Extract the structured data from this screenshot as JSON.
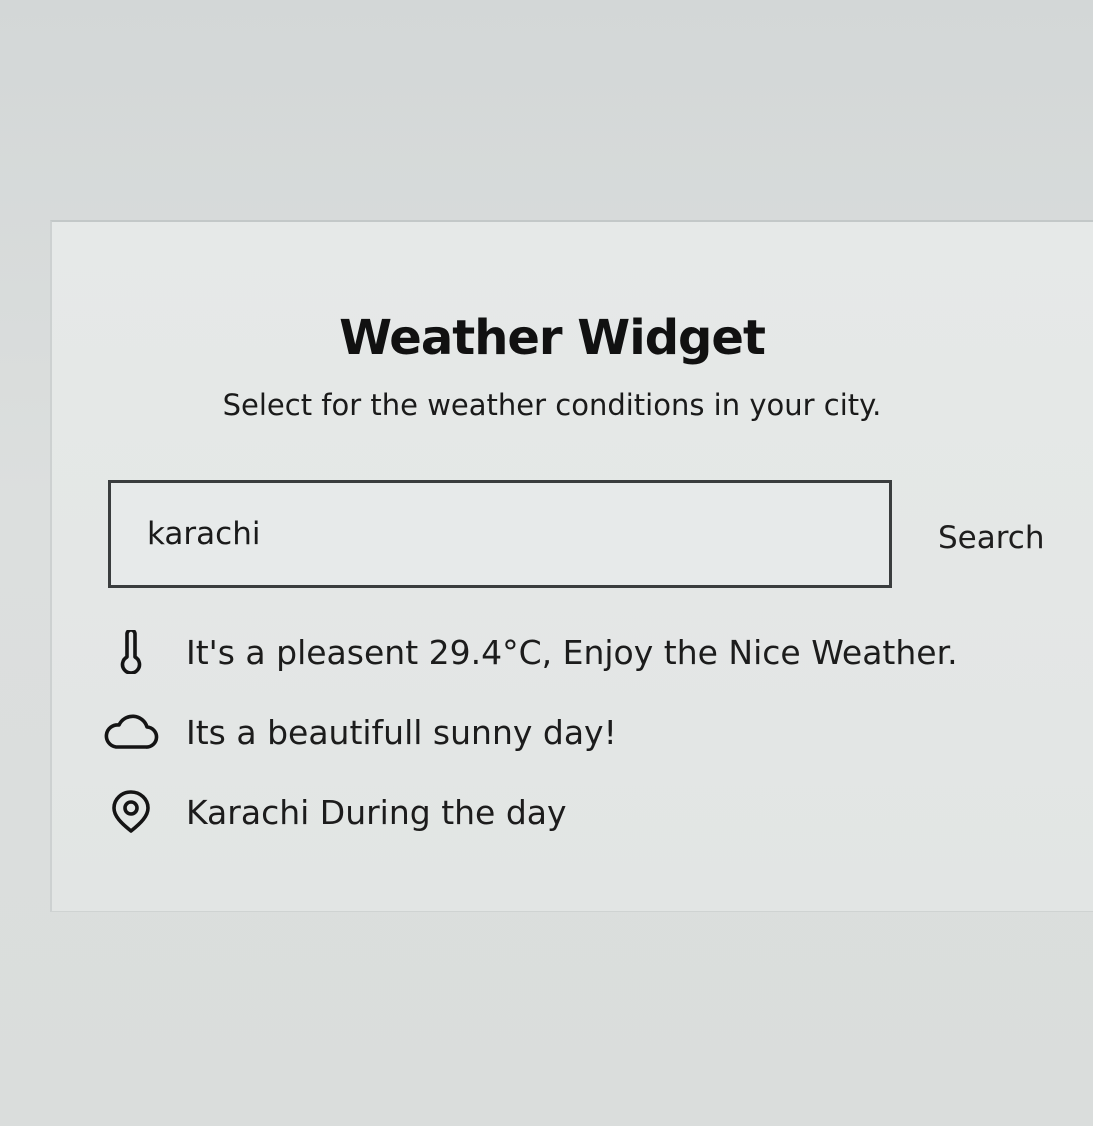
{
  "widget": {
    "title": "Weather Widget",
    "subtitle": "Select for the weather conditions in your city."
  },
  "search": {
    "value": "karachi",
    "placeholder": "",
    "button_label": "Search"
  },
  "results": [
    {
      "icon": "thermometer-icon",
      "text": "It's a pleasent 29.4°C, Enjoy the Nice Weather."
    },
    {
      "icon": "cloud-icon",
      "text": "Its a beautifull sunny day!"
    },
    {
      "icon": "location-pin-icon",
      "text": "Karachi During the day"
    }
  ]
}
